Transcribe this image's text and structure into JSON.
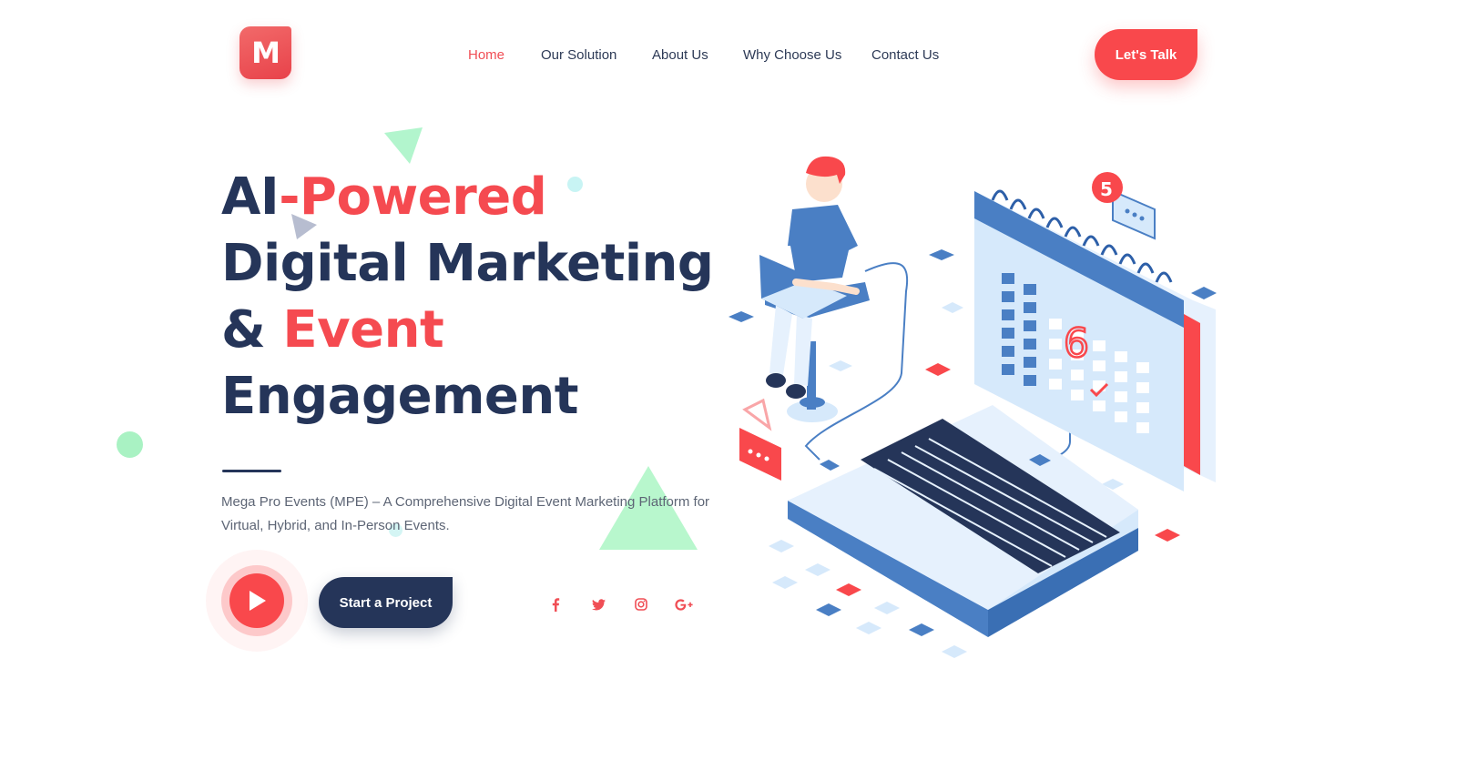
{
  "header": {
    "logo_letter": "M",
    "nav": [
      {
        "label": "Home",
        "active": true
      },
      {
        "label": "Our Solution",
        "active": false
      },
      {
        "label": "About Us",
        "active": false
      },
      {
        "label": "Why Choose Us",
        "active": false
      },
      {
        "label": "Contact Us",
        "active": false
      }
    ],
    "cta_label": "Let's Talk"
  },
  "hero": {
    "title_part1": "AI",
    "title_part2": "-Powered",
    "title_line2": "Digital Marketing",
    "title_line3_prefix": "& ",
    "title_line3_accent": "Event",
    "title_line4": "Engagement",
    "description": "Mega Pro Events (MPE) – A Comprehensive Digital Event Marketing Platform for Virtual, Hybrid, and In-Person Events.",
    "primary_button": "Start a Project"
  },
  "illustration": {
    "calendar_badge": "5",
    "calendar_circled_date": "6"
  },
  "social": [
    {
      "icon": "facebook-icon",
      "glyph": "f"
    },
    {
      "icon": "twitter-icon",
      "glyph": ""
    },
    {
      "icon": "instagram-icon",
      "glyph": ""
    },
    {
      "icon": "google-plus-icon",
      "glyph": "G+"
    }
  ],
  "colors": {
    "primary": "#f9484c",
    "navy": "#253559",
    "accent_green": "#a7f3c4",
    "light_blue": "#d6e9fb",
    "mid_blue": "#4a7fc4"
  }
}
